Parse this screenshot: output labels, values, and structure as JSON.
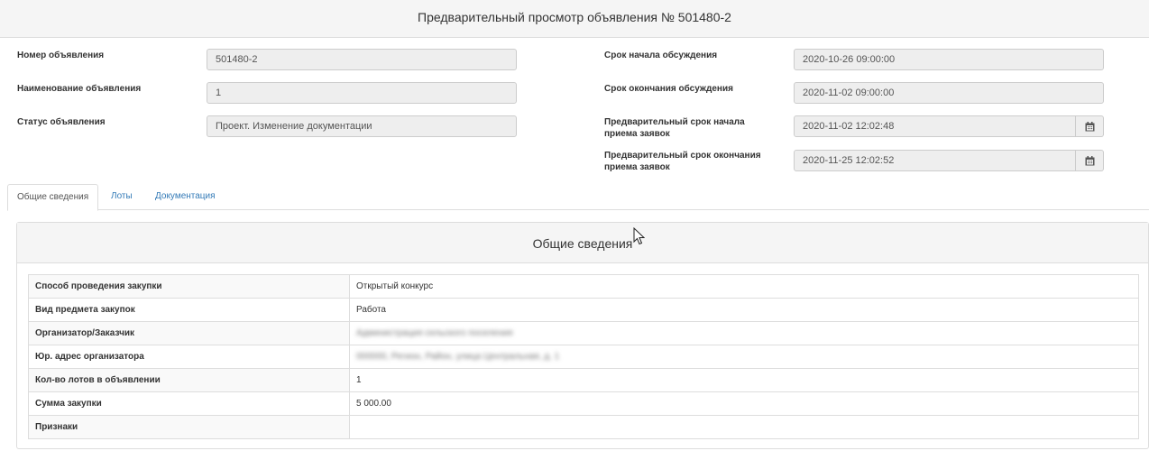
{
  "header": {
    "title": "Предварительный просмотр объявления № 501480-2"
  },
  "form": {
    "left": [
      {
        "label": "Номер объявления",
        "value": "501480-2"
      },
      {
        "label": "Наименование объявления",
        "value": "1"
      },
      {
        "label": "Статус объявления",
        "value": "Проект. Изменение документации"
      }
    ],
    "right": [
      {
        "label": "Срок начала обсуждения",
        "value": "2020-10-26 09:00:00"
      },
      {
        "label": "Срок окончания обсуждения",
        "value": "2020-11-02 09:00:00"
      },
      {
        "label_line1": "Предварительный срок начала",
        "label_line2": "приема заявок",
        "value": "2020-11-02 12:02:48",
        "icon": "calendar-icon"
      },
      {
        "label_line1": "Предварительный срок окончания",
        "label_line2": "приема заявок",
        "value": "2020-11-25 12:02:52",
        "icon": "calendar-icon"
      }
    ]
  },
  "tabs": [
    {
      "label": "Общие сведения",
      "active": true
    },
    {
      "label": "Лоты",
      "active": false
    },
    {
      "label": "Документация",
      "active": false
    }
  ],
  "panel": {
    "title": "Общие сведения",
    "rows": [
      {
        "key": "Способ проведения закупки",
        "value": "Открытый конкурс"
      },
      {
        "key": "Вид предмета закупок",
        "value": "Работа"
      },
      {
        "key": "Организатор/Заказчик",
        "value": "Администрация сельского поселения"
      },
      {
        "key": "Юр. адрес организатора",
        "value": "000000, Регион, Район, улица Центральная, д. 1"
      },
      {
        "key": "Кол-во лотов в объявлении",
        "value": "1"
      },
      {
        "key": "Сумма закупки",
        "value": "5 000.00"
      },
      {
        "key": "Признаки",
        "value": ""
      }
    ]
  }
}
